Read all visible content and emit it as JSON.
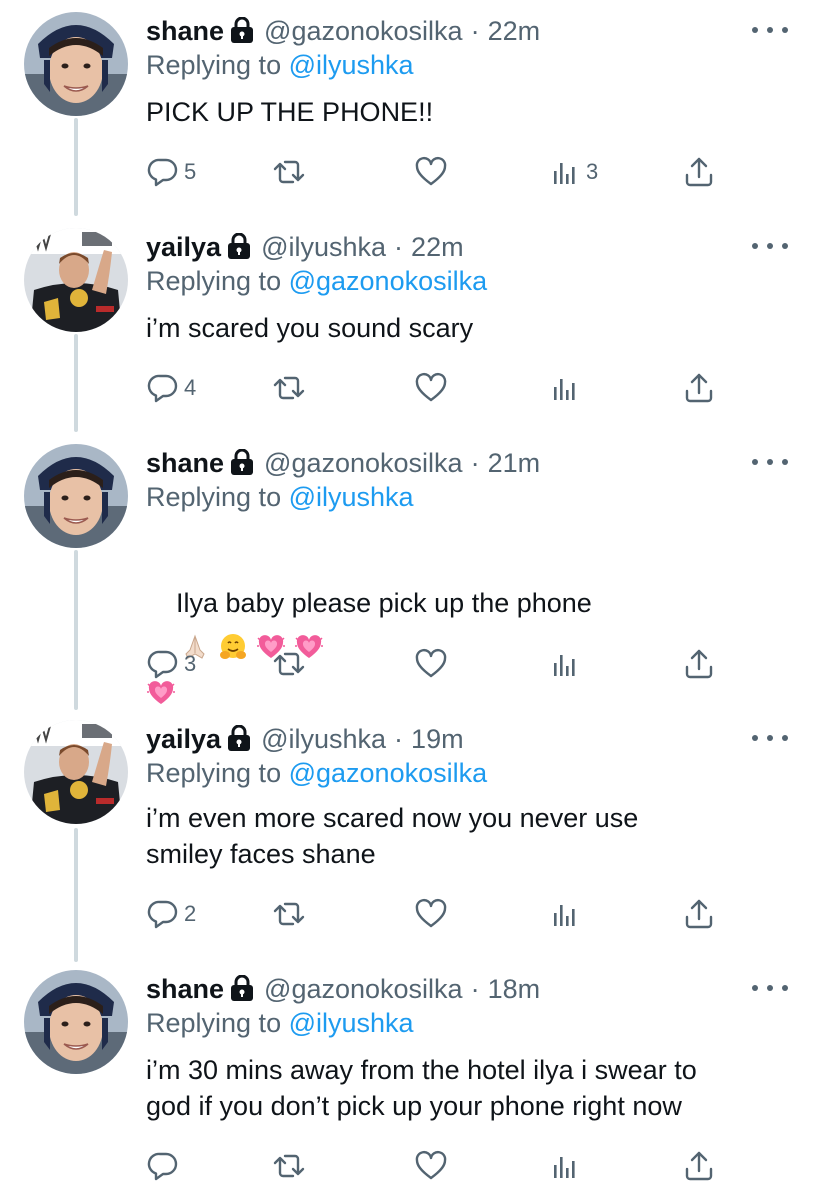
{
  "tweets": [
    {
      "name": "shane",
      "handle": "@gazonokosilka",
      "dot": "·",
      "time": "22m",
      "replying_prefix": "Replying to ",
      "replying_to": "@ilyushka",
      "text": "PICK UP THE PHONE!!",
      "reply_count": "5",
      "views_count": "3"
    },
    {
      "name": "yailya",
      "handle": "@ilyushka",
      "dot": "·",
      "time": "22m",
      "replying_prefix": "Replying to ",
      "replying_to": "@gazonokosilka",
      "text": "i’m scared you sound scary",
      "reply_count": "4",
      "views_count": ""
    },
    {
      "name": "shane",
      "handle": "@gazonokosilka",
      "dot": "·",
      "time": "21m",
      "replying_prefix": "Replying to ",
      "replying_to": "@ilyushka",
      "text": "Ilya baby please pick up the phone",
      "emojis": [
        "folded-hands",
        "hugging-face",
        "growing-heart",
        "growing-heart",
        "growing-heart"
      ],
      "reply_count": "3",
      "views_count": ""
    },
    {
      "name": "yailya",
      "handle": "@ilyushka",
      "dot": "·",
      "time": "19m",
      "replying_prefix": "Replying to ",
      "replying_to": "@gazonokosilka",
      "text": "i’m even more scared now you never use\nsmiley faces shane",
      "reply_count": "2",
      "views_count": ""
    },
    {
      "name": "shane",
      "handle": "@gazonokosilka",
      "dot": "·",
      "time": "18m",
      "replying_prefix": "Replying to ",
      "replying_to": "@ilyushka",
      "text": "i’m 30 mins away from the hotel ilya i swear to\ngod if you don’t pick up your phone right now",
      "reply_count": "",
      "views_count": ""
    }
  ],
  "icons": {
    "lock": "lock-icon",
    "more": "more-icon",
    "reply": "reply-icon",
    "retweet": "retweet-icon",
    "like": "heart-icon",
    "views": "views-icon",
    "share": "share-icon"
  },
  "colors": {
    "link": "#1d9bf0",
    "secondary": "#536471",
    "heart_emoji": "#f25c9a",
    "thread_line": "#cfd9de"
  }
}
